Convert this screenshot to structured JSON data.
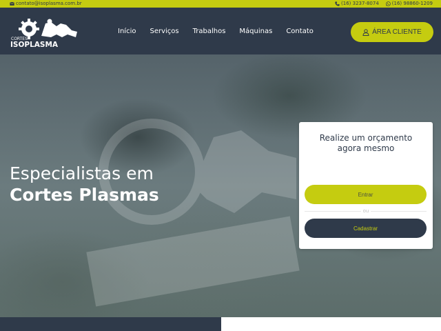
{
  "topbar": {
    "email": "contato@isoplasma.com.br",
    "phone": "(16) 3237-8074",
    "whatsapp": "(16) 98860-1209",
    "icons": {
      "email": "envelope-icon",
      "phone": "phone-icon",
      "whatsapp": "whatsapp-icon"
    }
  },
  "header": {
    "logo": {
      "small_text": "CORTES",
      "brand": "ISOPLASMA"
    },
    "nav": [
      {
        "label": "Início"
      },
      {
        "label": "Serviços"
      },
      {
        "label": "Trabalhos"
      },
      {
        "label": "Máquinas"
      },
      {
        "label": "Contato"
      }
    ],
    "client_button": {
      "label": "ÁREA CLIENTE",
      "icon": "user-icon"
    }
  },
  "hero": {
    "title_line1": "Especialistas em",
    "title_line2": "Cortes Plasmas"
  },
  "quote_card": {
    "title_line1": "Realize um orçamento",
    "title_line2": "agora mesmo",
    "enter_label": "Entrar",
    "or_label": "ou",
    "register_label": "Cadastrar"
  },
  "colors": {
    "brand_dark": "#2f3a4a",
    "brand_accent": "#c5cc10",
    "white": "#ffffff"
  }
}
